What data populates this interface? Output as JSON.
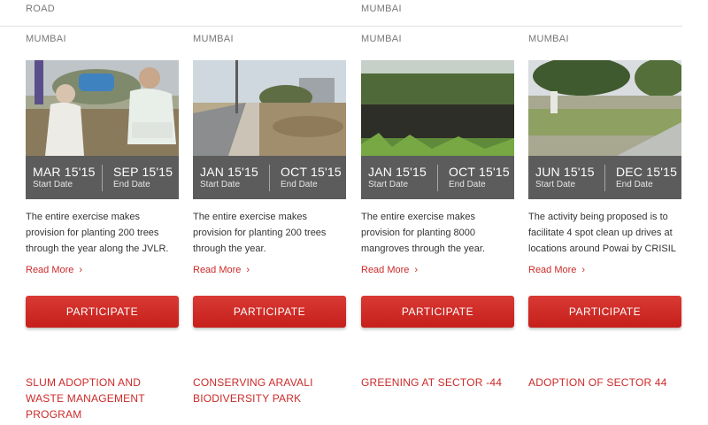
{
  "cards": [
    {
      "top_location": "ROAD",
      "location": "MUMBAI",
      "start_date": "MAR 15'15",
      "end_date": "SEP 15'15",
      "start_label": "Start Date",
      "end_label": "End Date",
      "description": "The entire exercise  makes provision for planting 200 trees through the year along the JVLR.",
      "read_more": "Read More",
      "button": "PARTICIPATE",
      "next_title": "SLUM ADOPTION AND WASTE MANAGEMENT PROGRAM"
    },
    {
      "top_location": "",
      "location": "MUMBAI",
      "start_date": "JAN 15'15",
      "end_date": "OCT 15'15",
      "start_label": "Start Date",
      "end_label": "End Date",
      "description": "The entire exercise  makes provision for planting 200 trees through the year.",
      "read_more": "Read More",
      "button": "PARTICIPATE",
      "next_title": "CONSERVING ARAVALI BIODIVERSITY PARK"
    },
    {
      "top_location": "MUMBAI",
      "location": "MUMBAI",
      "start_date": "JAN 15'15",
      "end_date": "OCT 15'15",
      "start_label": "Start Date",
      "end_label": "End Date",
      "description": "The entire exercise  makes provision for planting 8000 mangroves through the year.",
      "read_more": "Read More",
      "button": "PARTICIPATE",
      "next_title": "GREENING AT SECTOR -44"
    },
    {
      "top_location": "",
      "location": "MUMBAI",
      "start_date": "JUN 15'15",
      "end_date": "DEC 15'15",
      "start_label": "Start Date",
      "end_label": "End Date",
      "description": " The activity being proposed is to facilitate 4 spot clean up drives at locations around Powai by CRISIL",
      "read_more": "Read More",
      "button": "PARTICIPATE",
      "next_title": "ADOPTION OF SECTOR 44"
    }
  ],
  "icons": {
    "read_more": "chevron-right-icon"
  },
  "colors": {
    "accent": "#cc2a2a",
    "button": "#d2302b",
    "date_overlay": "#464646"
  }
}
